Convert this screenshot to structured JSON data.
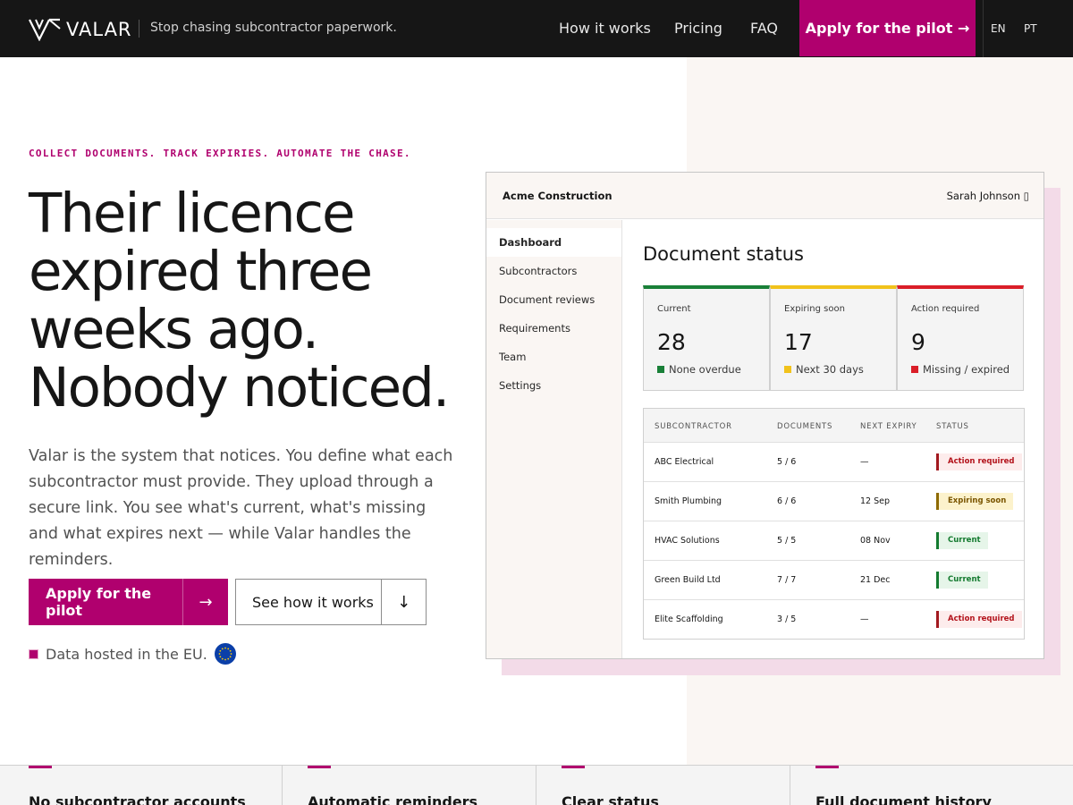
{
  "nav": {
    "brand": "VALAR",
    "tagline": "Stop chasing subcontractor paperwork.",
    "links": [
      "How it works",
      "Pricing",
      "FAQ"
    ],
    "cta": "Apply for the pilot →",
    "languages": [
      "EN",
      "PT"
    ]
  },
  "hero": {
    "eyebrow": "COLLECT DOCUMENTS. TRACK EXPIRIES. AUTOMATE THE CHASE.",
    "headline_lines": [
      "Their licence",
      "expired three",
      "weeks ago.",
      "Nobody noticed."
    ],
    "lead": "Valar is the system that notices. You define what each subcontractor must provide. They upload through a secure link. You see what's current, what's missing and what expires next — while Valar handles the reminders.",
    "primary_button": "Apply for the pilot",
    "primary_arrow": "→",
    "secondary_button": "See how it works",
    "secondary_arrow": "↓",
    "eu_note": "Data hosted in the EU."
  },
  "mockup": {
    "company": "Acme Construction",
    "user": "Sarah Johnson ▯",
    "sidebar": [
      "Dashboard",
      "Subcontractors",
      "Document reviews",
      "Requirements",
      "Team",
      "Settings"
    ],
    "title": "Document status",
    "stats": [
      {
        "label": "Current",
        "value": "28",
        "sub": "None overdue",
        "color": "#198038"
      },
      {
        "label": "Expiring soon",
        "value": "17",
        "sub": "Next 30 days",
        "color": "#f1c21b"
      },
      {
        "label": "Action required",
        "value": "9",
        "sub": "Missing / expired",
        "color": "#da1e28"
      }
    ],
    "table": {
      "headers": [
        "SUBCONTRACTOR",
        "DOCUMENTS",
        "NEXT EXPIRY",
        "STATUS"
      ],
      "rows": [
        {
          "name": "ABC Electrical",
          "docs": "5 / 6",
          "expiry": "—",
          "status": "Action required",
          "kind": "action"
        },
        {
          "name": "Smith Plumbing",
          "docs": "6 / 6",
          "expiry": "12 Sep",
          "status": "Expiring soon",
          "kind": "soon"
        },
        {
          "name": "HVAC Solutions",
          "docs": "5 / 5",
          "expiry": "08 Nov",
          "status": "Current",
          "kind": "current"
        },
        {
          "name": "Green Build Ltd",
          "docs": "7 / 7",
          "expiry": "21 Dec",
          "status": "Current",
          "kind": "current"
        },
        {
          "name": "Elite Scaffolding",
          "docs": "3 / 5",
          "expiry": "—",
          "status": "Action required",
          "kind": "action"
        }
      ]
    }
  },
  "features": [
    "No subcontractor accounts",
    "Automatic reminders",
    "Clear status",
    "Full document history"
  ],
  "colors": {
    "accent": "#b0006e",
    "nav_bg": "#161616",
    "panel_bg": "#faf6f3",
    "shadow": "#f3dbe8"
  }
}
